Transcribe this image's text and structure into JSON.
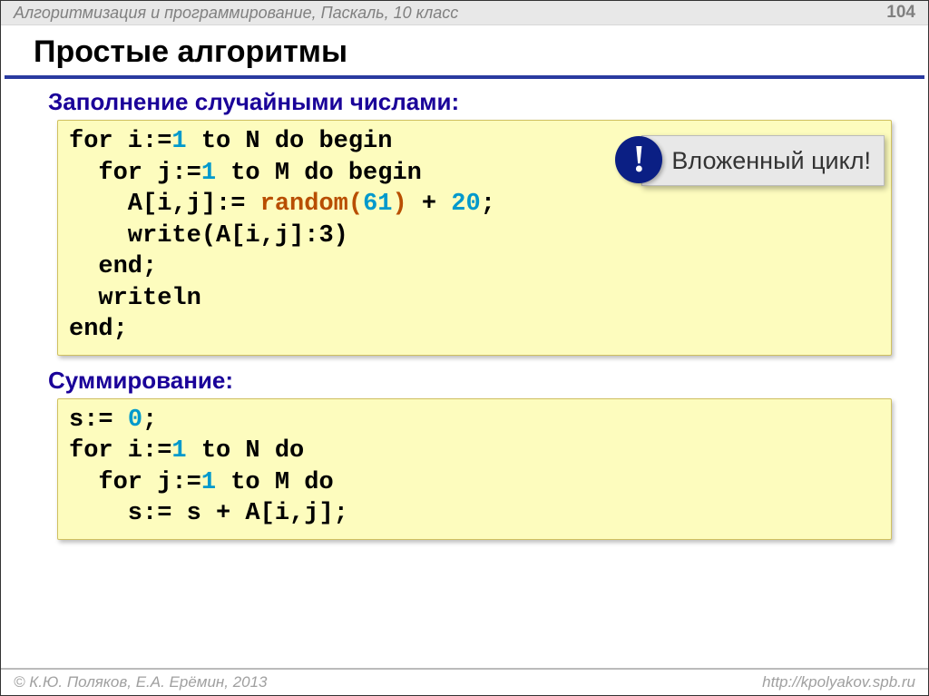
{
  "header": {
    "subject": "Алгоритмизация и программирование, Паскаль, 10 класс",
    "page": "104"
  },
  "title": "Простые алгоритмы",
  "section1": {
    "heading": "Заполнение случайными числами:",
    "code": {
      "l1a": "for i:=",
      "l1n": "1",
      "l1b": " to N do begin",
      "l2a": "  for j:=",
      "l2n": "1",
      "l2b": " to M do begin",
      "l3a": "    A[i,j]:= ",
      "l3fn": "random",
      "l3p1": "(",
      "l3n1": "61",
      "l3p2": ")",
      "l3op": " + ",
      "l3n2": "20",
      "l3e": ";",
      "l4": "    write(A[i,j]:3)",
      "l5": "  end;",
      "l6": "  writeln",
      "l7": "end;"
    }
  },
  "callout": {
    "badge": "!",
    "text": "Вложенный цикл!"
  },
  "section2": {
    "heading": "Суммирование:",
    "code": {
      "l1a": "s:= ",
      "l1n": "0",
      "l1e": ";",
      "l2a": "for i:=",
      "l2n": "1",
      "l2b": " to N do",
      "l3a": "  for j:=",
      "l3n": "1",
      "l3b": " to M do",
      "l4": "    s:= s + A[i,j];"
    }
  },
  "footer": {
    "authors": "К.Ю. Поляков, Е.А. Ерёмин, 2013",
    "url": "http://kpolyakov.spb.ru",
    "copyright": "© "
  }
}
